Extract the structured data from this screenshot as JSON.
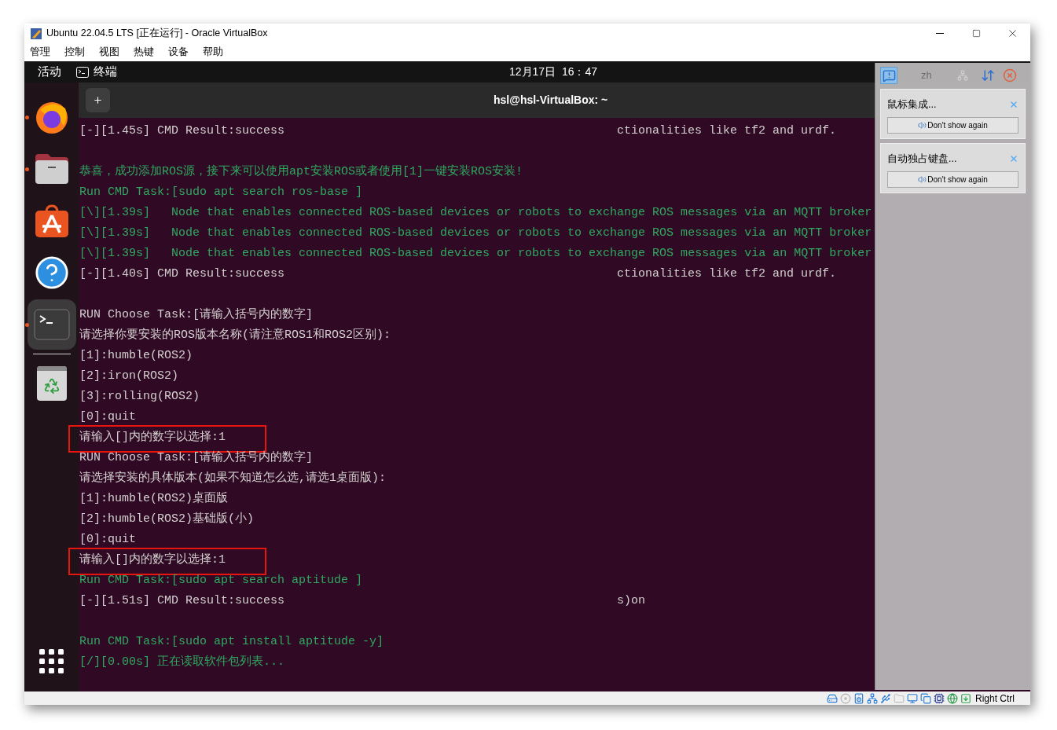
{
  "window": {
    "title": "Ubuntu 22.04.5 LTS [正在运行] - Oracle VirtualBox"
  },
  "menu": [
    "管理",
    "控制",
    "视图",
    "热键",
    "设备",
    "帮助"
  ],
  "topbar": {
    "activities": "活动",
    "app": "终端",
    "clock": "12月17日  16：47"
  },
  "dock": [
    {
      "kind": "browser",
      "running": true,
      "selected": false
    },
    {
      "kind": "files",
      "running": true,
      "selected": false
    },
    {
      "kind": "store",
      "running": false,
      "selected": false
    },
    {
      "kind": "help",
      "running": false,
      "selected": false
    },
    {
      "kind": "terminal",
      "running": true,
      "selected": true
    },
    {
      "kind": "trash",
      "running": false,
      "selected": false
    }
  ],
  "terminal": {
    "title": "hsl@hsl-VirtualBox: ~",
    "lines": [
      {
        "kind": "white",
        "text": "[-][1.45s] CMD Result:success",
        "right": "ctionalities like tf2 and urdf.",
        "highlighted": false
      },
      {
        "kind": "blank"
      },
      {
        "kind": "green",
        "text": "恭喜，成功添加ROS源，接下来可以使用apt安装ROS或者使用[1]一键安装ROS安装!",
        "highlighted": false
      },
      {
        "kind": "green",
        "text": "Run CMD Task:[sudo apt search ros-base ]",
        "highlighted": false
      },
      {
        "kind": "green",
        "text": "[\\][1.39s]   Node that enables connected ROS-based devices or robots to exchange ROS messages via an MQTT broker",
        "highlighted": false
      },
      {
        "kind": "green",
        "text": "[\\][1.39s]   Node that enables connected ROS-based devices or robots to exchange ROS messages via an MQTT broker",
        "highlighted": false
      },
      {
        "kind": "green",
        "text": "[\\][1.39s]   Node that enables connected ROS-based devices or robots to exchange ROS messages via an MQTT broker",
        "highlighted": false
      },
      {
        "kind": "white",
        "text": "[-][1.40s] CMD Result:success",
        "right": "ctionalities like tf2 and urdf.",
        "highlighted": false
      },
      {
        "kind": "blank"
      },
      {
        "kind": "white",
        "text": "RUN Choose Task:[请输入括号内的数字]",
        "highlighted": false
      },
      {
        "kind": "white",
        "text": "请选择你要安装的ROS版本名称(请注意ROS1和ROS2区别):",
        "highlighted": false
      },
      {
        "kind": "white",
        "text": "[1]:humble(ROS2)",
        "highlighted": false
      },
      {
        "kind": "white",
        "text": "[2]:iron(ROS2)",
        "highlighted": false
      },
      {
        "kind": "white",
        "text": "[3]:rolling(ROS2)",
        "highlighted": false
      },
      {
        "kind": "white",
        "text": "[0]:quit",
        "highlighted": false
      },
      {
        "kind": "white",
        "text": "请输入[]内的数字以选择:1",
        "highlighted": true
      },
      {
        "kind": "white",
        "text": "RUN Choose Task:[请输入括号内的数字]",
        "highlighted": false
      },
      {
        "kind": "white",
        "text": "请选择安装的具体版本(如果不知道怎么选,请选1桌面版):",
        "highlighted": false
      },
      {
        "kind": "white",
        "text": "[1]:humble(ROS2)桌面版",
        "highlighted": false
      },
      {
        "kind": "white",
        "text": "[2]:humble(ROS2)基础版(小)",
        "highlighted": false
      },
      {
        "kind": "white",
        "text": "[0]:quit",
        "highlighted": false
      },
      {
        "kind": "white",
        "text": "请输入[]内的数字以选择:1",
        "highlighted": true
      },
      {
        "kind": "green",
        "text": "Run CMD Task:[sudo apt search aptitude ]",
        "highlighted": false
      },
      {
        "kind": "white",
        "text": "[-][1.51s] CMD Result:success",
        "right": "s)on",
        "highlighted": false
      },
      {
        "kind": "blank"
      },
      {
        "kind": "green",
        "text": "Run CMD Task:[sudo apt install aptitude -y]",
        "highlighted": false
      },
      {
        "kind": "green",
        "text": "[/][0.00s] 正在读取软件包列表...",
        "highlighted": false
      }
    ]
  },
  "notifications": {
    "language": "zh",
    "items": [
      {
        "title": "鼠标集成...",
        "button": "Don't show again"
      },
      {
        "title": "自动独占键盘...",
        "button": "Don't show again"
      }
    ]
  },
  "status_bar": {
    "host_key": "Right Ctrl"
  }
}
